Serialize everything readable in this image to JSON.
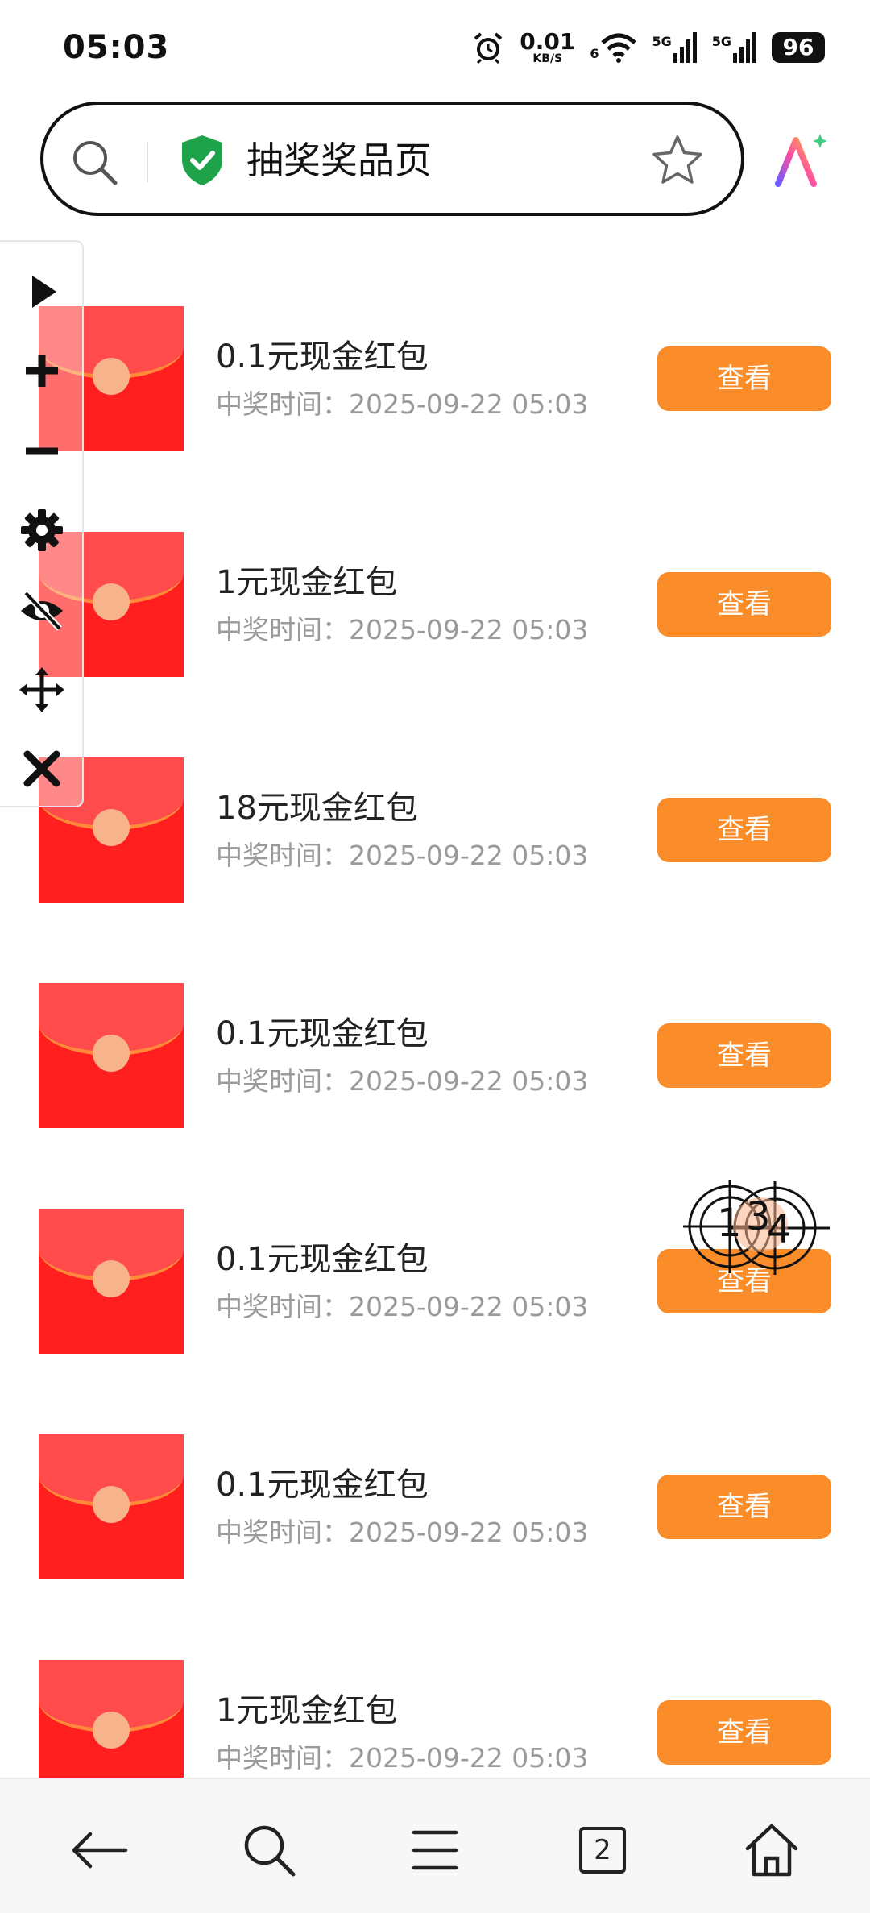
{
  "status_bar": {
    "time": "05:03",
    "net_speed_value": "0.01",
    "net_speed_unit": "KB/S",
    "wifi_label": "6",
    "signal1_label": "5G",
    "signal2_label": "5G",
    "battery": "96"
  },
  "address_bar": {
    "title": "抽奖奖品页"
  },
  "list": {
    "items": [
      {
        "title": "0.1元现金红包",
        "time_label": "中奖时间：",
        "time_value": "2025-09-22 05:03",
        "button": "查看"
      },
      {
        "title": "1元现金红包",
        "time_label": "中奖时间：",
        "time_value": "2025-09-22 05:03",
        "button": "查看"
      },
      {
        "title": "18元现金红包",
        "time_label": "中奖时间：",
        "time_value": "2025-09-22 05:03",
        "button": "查看"
      },
      {
        "title": "0.1元现金红包",
        "time_label": "中奖时间：",
        "time_value": "2025-09-22 05:03",
        "button": "查看"
      },
      {
        "title": "0.1元现金红包",
        "time_label": "中奖时间：",
        "time_value": "2025-09-22 05:03",
        "button": "查看"
      },
      {
        "title": "0.1元现金红包",
        "time_label": "中奖时间：",
        "time_value": "2025-09-22 05:03",
        "button": "查看"
      },
      {
        "title": "1元现金红包",
        "time_label": "中奖时间：",
        "time_value": "2025-09-22 05:03",
        "button": "查看"
      }
    ]
  },
  "overlay": {
    "markers": [
      "1",
      "3",
      "4"
    ]
  },
  "bottom_nav": {
    "tab_count": "2"
  },
  "colors": {
    "accent_orange": "#fb8c2a",
    "envelope_red": "#ff1f1f",
    "shield_green": "#1fa34a"
  },
  "icons": {
    "tools": [
      "play-icon",
      "plus-icon",
      "minus-icon",
      "gear-icon",
      "eye-off-icon",
      "move-icon",
      "close-icon"
    ],
    "nav": [
      "back-arrow-icon",
      "search-icon",
      "menu-icon",
      "tabs-icon",
      "home-icon"
    ]
  }
}
